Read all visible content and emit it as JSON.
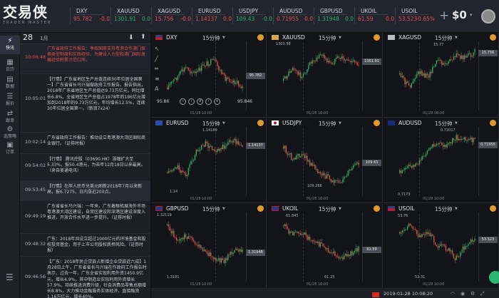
{
  "header": {
    "logo_text": "交易侠",
    "logo_sub": "TRADER MASTER",
    "add_icon": "plus-icon",
    "balance_label": "$0",
    "caret": "▾"
  },
  "tickers": [
    {
      "sym": "DXY",
      "price": "95.782",
      "change": "-0.0",
      "dir": "down"
    },
    {
      "sym": "XAUUSD",
      "price": "1301.91",
      "change": "0.0",
      "dir": "up"
    },
    {
      "sym": "XAGUSD",
      "price": "15.756",
      "change": "-0.0",
      "dir": "down"
    },
    {
      "sym": "EURUSD",
      "price": "1.14137",
      "change": "0.0",
      "dir": "down"
    },
    {
      "sym": "USDJPY",
      "price": "109.43",
      "change": "-0.0",
      "dir": "up"
    },
    {
      "sym": "AUDUSD",
      "price": "0.71955",
      "change": "0.0",
      "dir": "down"
    },
    {
      "sym": "GBPUSD",
      "price": "1.31948",
      "change": "0.0",
      "dir": "up"
    },
    {
      "sym": "UKOIL",
      "price": "61.59",
      "change": "0.0",
      "dir": "down"
    },
    {
      "sym": "USOIL",
      "price": "53.523",
      "change": "-0.65%",
      "dir": "down"
    }
  ],
  "rail": [
    {
      "label": "快讯",
      "icon": "flash-icon",
      "glyph": "⚡"
    },
    {
      "label": "日历",
      "icon": "calendar-icon",
      "glyph": "▦"
    },
    {
      "label": "数据",
      "icon": "data-icon",
      "glyph": "▤"
    },
    {
      "label": "报价",
      "icon": "quote-icon",
      "glyph": "☰"
    },
    {
      "label": "跟单",
      "icon": "follow-icon",
      "glyph": "⇄"
    },
    {
      "label": "选策略",
      "icon": "strategy-icon",
      "glyph": "⚙"
    },
    {
      "label": "订单",
      "icon": "order-icon",
      "glyph": "▣"
    }
  ],
  "news_header": {
    "day": "28",
    "month": "1月",
    "download_icon": "⬇",
    "upload_icon": "⬆"
  },
  "news": [
    {
      "time": "10:06:48",
      "text": "广东省政府工作报告：争取国家支持粤港合作澳门探索类型制度和实践经验，为建设人力型和澳门国际发展经验积累示范口岸。",
      "hl": true
    },
    {
      "time": "10:05:01",
      "text": "【行情】广东省地区生产总值连续30年位居全国第一】广东省省长马兴瑞做政府工作报告。报告指出，2018年广东省地区生产总值达9.73万亿元，同比增长6.8%。全省地区生产总值占1978年的186亿元增加到2018年的9.73万亿元，年均增长12.5%，连续30年位居全国第一。（新浪7x24）",
      "hl": false
    },
    {
      "time": "10:02:14",
      "text": "广东省政府工作报告：推动设立粤港澳大湾区国际商业银行。（证券时报）",
      "hl": false
    },
    {
      "time": "09:54:02",
      "text": "【行情】 腾讯控股（03690.HK）涨幅扩大至5.33%，报50.4港元，为去年12月18日以来最高。（来自美通电讯）",
      "hl": false
    },
    {
      "time": "09:53:45",
      "text": "【行情】在岸人民币兑美元刷新2018年7月以来新高，报6.7275，日内涨近200点。",
      "hl": false
    },
    {
      "time": "09:49:19",
      "text": "广东省省长马兴瑞：一年来，广东着眼拓展海外市场粤港澳大湾区建设，自贸区建设和深港区建设深度入推进，开放合作水平进一步提升。（证券时报）",
      "hl": false
    },
    {
      "time": "09:48:32",
      "text": "广东：2018年共设立超过1000亿元的环境基金和股权投资基金，用于上市公司股权质押风险。（证券时报）",
      "hl": false
    },
    {
      "time": "09:46:56",
      "text": "【广东：2018年民企贷款占新增企业贷款近六成】1月28日上午，广东省省长马兴瑞在作政府工作报告时表示，过去一年，广东全省实现利用外资1450.9亿元，增长4.9%，其中制造业实际利用外资增长57.9%。持续推进消费升级，社会消费品零售总额增长8.8%，大力推动金融服务实体经济，直接融资1.16万亿元，增长40%。",
      "hl": false
    }
  ],
  "panels": [
    {
      "sym": "DXY",
      "tf": "15分钟",
      "flag": "flag-us",
      "last": "95.782",
      "high": "",
      "low": "",
      "date": "01/28 10:00",
      "nav_lo": "95.86",
      "nav_hi": "95.846"
    },
    {
      "sym": "XAUUSD",
      "tf": "15分钟",
      "flag": "flag-gold",
      "last": "1301.91",
      "high": "1303.58",
      "low": "",
      "date": "01/28 10:00"
    },
    {
      "sym": "XAGUSD",
      "tf": "15分钟",
      "flag": "flag-silver",
      "last": "15.756",
      "high": "15.77",
      "low": "",
      "date": "01/28 08:00"
    },
    {
      "sym": "EURUSD",
      "tf": "15分钟",
      "flag": "flag-eu",
      "last": "1.14137",
      "high": "1.14189",
      "low": "1.14",
      "date": "01/28 10:00"
    },
    {
      "sym": "USDJPY",
      "tf": "15分钟",
      "flag": "flag-jp",
      "last": "109.43",
      "high": "",
      "low": "109.266",
      "date": "01/28 10:00"
    },
    {
      "sym": "AUDUSD",
      "tf": "15分钟",
      "flag": "flag-au",
      "last": "0.71955",
      "high": "0.72017",
      "low": "0.7173",
      "date": "01/28 10:00"
    },
    {
      "sym": "GBPUSD",
      "tf": "15分钟",
      "flag": "flag-gb",
      "last": "1.31948",
      "high": "1.32119",
      "low": "1.3181",
      "date": "01/28 10:00"
    },
    {
      "sym": "UKOIL",
      "tf": "15分钟",
      "flag": "flag-gb",
      "last": "61.59",
      "high": "61.845",
      "low": "61.23",
      "date": "01/28 10:00"
    },
    {
      "sym": "USOIL",
      "tf": "15分钟",
      "flag": "flag-us",
      "last": "53.523",
      "high": "53.76",
      "low": "53.31",
      "date": "01/28 10:00"
    }
  ],
  "status": {
    "time": "2019-01-28 10:08:20"
  },
  "colors": {
    "up": "#31b36a",
    "down": "#e05252",
    "accent": "#e09a2c"
  }
}
